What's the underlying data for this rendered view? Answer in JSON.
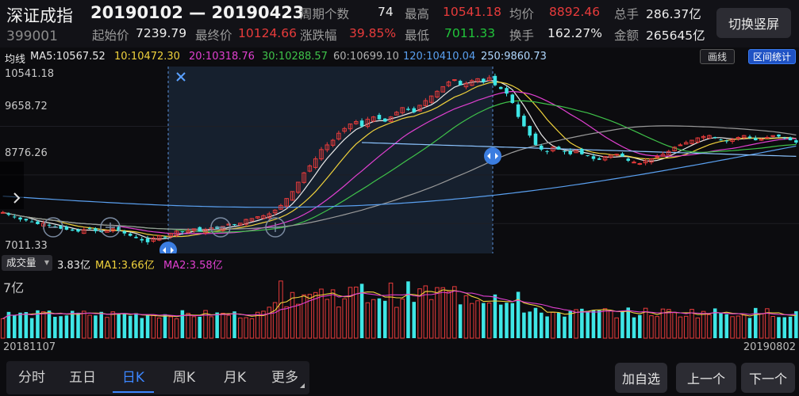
{
  "header": {
    "index_name": "深证成指",
    "date_range": "20190102 — 20190423",
    "index_code": "399001",
    "portrait_button": "切换竖屏",
    "stats": [
      {
        "key": "周期个数",
        "value": "74",
        "color": "white"
      },
      {
        "key": "最高",
        "value": "10541.18",
        "color": "red"
      },
      {
        "key": "均价",
        "value": "8892.46",
        "color": "red"
      },
      {
        "key": "总手",
        "value": "286.37亿",
        "color": "white"
      },
      {
        "key": "起始价",
        "value": "7239.79",
        "color": "white"
      },
      {
        "key": "最终价",
        "value": "10124.66",
        "color": "red"
      },
      {
        "key": "涨跌幅",
        "value": "39.85%",
        "color": "red"
      },
      {
        "key": "最低",
        "value": "7011.33",
        "color": "green"
      },
      {
        "key": "换手",
        "value": "162.27%",
        "color": "white"
      },
      {
        "key": "金额",
        "value": "265645亿",
        "color": "white"
      }
    ]
  },
  "ma_bar": {
    "label": "均线",
    "items": [
      {
        "text": "MA5:10567.52",
        "color": "#e8e8e8"
      },
      {
        "text": "10:10472.30",
        "color": "#f0d23c"
      },
      {
        "text": "20:10318.76",
        "color": "#e040d0"
      },
      {
        "text": "30:10288.57",
        "color": "#3fc34a"
      },
      {
        "text": "60:10699.10",
        "color": "#b0b0b0"
      },
      {
        "text": "120:10410.04",
        "color": "#5aa0f0"
      },
      {
        "text": "250:9860.73",
        "color": "#b0d8ff"
      }
    ],
    "draw_button": "画线",
    "stats_button": "区间统计"
  },
  "price_axis": {
    "labels": [
      "10541.18",
      "9658.72",
      "8776.26",
      "7011.33"
    ]
  },
  "volume": {
    "selector": "成交量",
    "value": "3.83亿",
    "ma1": "MA1:3.66亿",
    "ma2": "MA2:3.58亿",
    "max_label": "7亿"
  },
  "dates": {
    "start": "20181107",
    "end": "20190802"
  },
  "tabs": [
    {
      "label": "分时",
      "active": false
    },
    {
      "label": "五日",
      "active": false
    },
    {
      "label": "日K",
      "active": true
    },
    {
      "label": "周K",
      "active": false
    },
    {
      "label": "月K",
      "active": false
    },
    {
      "label": "更多",
      "active": false
    }
  ],
  "actions": {
    "add_watch": "加自选",
    "prev": "上一个",
    "next": "下一个"
  },
  "colors": {
    "up": "#e83b3b",
    "down": "#3ee6e6",
    "selection": "#1d2a3d",
    "accent": "#3c86ff"
  },
  "chart_data": {
    "type": "candlestick",
    "period": "daily",
    "selected_range": [
      "20190102",
      "20190423"
    ],
    "price_range": [
      7011.33,
      10541.18
    ],
    "close_approx": [
      7650,
      7600,
      7550,
      7500,
      7480,
      7450,
      7400,
      7420,
      7380,
      7350,
      7300,
      7280,
      7260,
      7240,
      7280,
      7300,
      7250,
      7230,
      7260,
      7300,
      7250,
      7200,
      7150,
      7100,
      7050,
      7011,
      7100,
      7150,
      7120,
      7200,
      7250,
      7230,
      7260,
      7300,
      7240,
      7280,
      7320,
      7300,
      7350,
      7400,
      7380,
      7420,
      7500,
      7520,
      7560,
      7580,
      7620,
      7700,
      7800,
      7950,
      8100,
      8300,
      8500,
      8650,
      8800,
      9000,
      9100,
      9200,
      9350,
      9450,
      9550,
      9600,
      9500,
      9650,
      9700,
      9650,
      9600,
      9700,
      9800,
      9900,
      9850,
      9800,
      9950,
      10050,
      10150,
      10250,
      10350,
      10450,
      10500,
      10380,
      10420,
      10480,
      10520,
      10450,
      10541,
      10380,
      10300,
      10200,
      10000,
      9700,
      9500,
      9300,
      9100,
      9000,
      8950,
      9050,
      9000,
      8950,
      8900,
      8980,
      8900,
      8870,
      8800,
      8780,
      8850,
      8880,
      8900,
      8850,
      8760,
      8730,
      8700,
      8760,
      8800,
      8850,
      8900,
      8960,
      9050,
      9100,
      9150,
      9200,
      9250,
      9280,
      9300,
      9250,
      9200,
      9180,
      9220,
      9260,
      9300,
      9250,
      9200,
      9220,
      9260,
      9300,
      9280,
      9240,
      9200,
      9150
    ],
    "volume_max_label": "7亿"
  }
}
